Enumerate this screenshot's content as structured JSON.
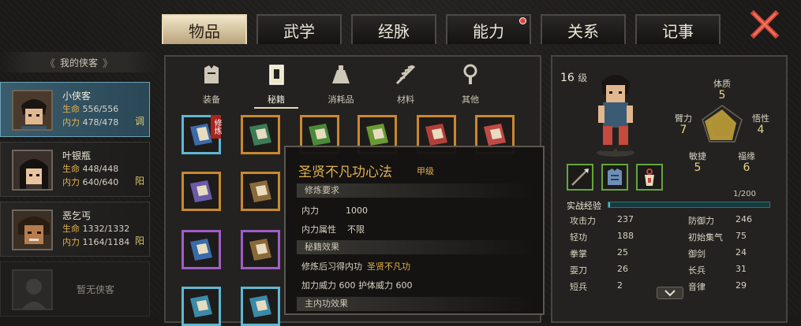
{
  "tabs": [
    {
      "label": "物品",
      "active": true
    },
    {
      "label": "武学"
    },
    {
      "label": "经脉"
    },
    {
      "label": "能力",
      "notify": true
    },
    {
      "label": "关系"
    },
    {
      "label": "记事"
    }
  ],
  "close_icon": "close-x-icon",
  "party": {
    "header": "我的侠客",
    "members": [
      {
        "name": "小侠客",
        "hp_label": "生命",
        "hp": "556/556",
        "mp_label": "内力",
        "mp": "478/478",
        "tag": "调",
        "selected": true
      },
      {
        "name": "叶银瓶",
        "hp_label": "生命",
        "hp": "448/448",
        "mp_label": "内力",
        "mp": "640/640",
        "tag": "阳"
      },
      {
        "name": "恶乞丐",
        "hp_label": "生命",
        "hp": "1332/1332",
        "mp_label": "内力",
        "mp": "1164/1184",
        "tag": "阳"
      }
    ],
    "empty_label": "暂无侠客"
  },
  "inventory": {
    "categories": [
      {
        "label": "装备",
        "icon": "armor-icon"
      },
      {
        "label": "秘籍",
        "icon": "book-icon",
        "active": true
      },
      {
        "label": "消耗品",
        "icon": "potion-icon"
      },
      {
        "label": "材料",
        "icon": "herb-icon"
      },
      {
        "label": "其他",
        "icon": "amulet-icon"
      }
    ],
    "first_badge": "修炼"
  },
  "tooltip": {
    "title": "圣贤不凡功心法",
    "grade": "甲级",
    "sec_req": "修炼要求",
    "req1_k": "内力",
    "req1_v": "1000",
    "req2_k": "内力属性",
    "req2_v": "不限",
    "sec_effect": "秘籍效果",
    "eff1_k": "修炼后习得内功",
    "eff1_v": "圣贤不凡功",
    "eff2_k1": "加力威力",
    "eff2_v1": "600",
    "eff2_k2": "护体威力",
    "eff2_v2": "600",
    "sec_main": "主内功效果"
  },
  "character": {
    "level": "16",
    "level_unit": "级",
    "radar": [
      {
        "label": "体质",
        "value": "5"
      },
      {
        "label": "悟性",
        "value": "4"
      },
      {
        "label": "福缘",
        "value": "6"
      },
      {
        "label": "敏捷",
        "value": "5"
      },
      {
        "label": "臂力",
        "value": "7"
      }
    ],
    "equip": [
      "spear-icon",
      "armor-icon",
      "charm-icon"
    ],
    "exp_label": "实战经验",
    "exp_text": "1/200",
    "exp_progress": 0.005,
    "attrs": [
      {
        "k": "攻击力",
        "v": "237"
      },
      {
        "k": "防御力",
        "v": "246"
      },
      {
        "k": "轻功",
        "v": "188"
      },
      {
        "k": "初始集气",
        "v": "75"
      },
      {
        "k": "拳掌",
        "v": "25"
      },
      {
        "k": "御剑",
        "v": "24"
      },
      {
        "k": "耍刀",
        "v": "26"
      },
      {
        "k": "长兵",
        "v": "31"
      },
      {
        "k": "短兵",
        "v": "2"
      },
      {
        "k": "音律",
        "v": "29"
      }
    ]
  },
  "colors": {
    "gold": "#e2b04f",
    "selected": "#3a5d6e",
    "exp": "#4fbac2",
    "equip_border": "#62a63e"
  }
}
